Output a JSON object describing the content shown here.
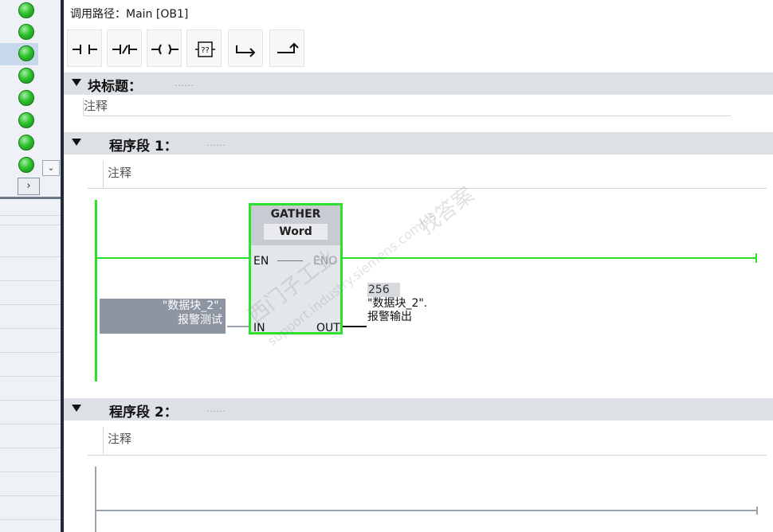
{
  "left_panel": {
    "status_icons": [
      "green-ok-icon",
      "green-ok-icon",
      "green-ok-icon",
      "green-ok-icon",
      "green-ok-icon",
      "green-ok-icon",
      "green-ok-icon",
      "green-ok-icon"
    ],
    "selected_row": 2,
    "dropdown_arrow": "⌄",
    "scroll_arrow": "›"
  },
  "editor": {
    "call_path_label": "调用路径：",
    "call_path_value": "Main [OB1]",
    "toolbar": [
      {
        "name": "normally-open-contact-button",
        "icon": "no-contact-icon"
      },
      {
        "name": "normally-closed-contact-button",
        "icon": "nc-contact-icon"
      },
      {
        "name": "coil-button",
        "icon": "coil-icon"
      },
      {
        "name": "empty-box-button",
        "icon": "empty-box-icon",
        "text": "??"
      },
      {
        "name": "open-branch-button",
        "icon": "open-branch-icon"
      },
      {
        "name": "close-branch-button",
        "icon": "close-branch-icon"
      }
    ],
    "block_title": {
      "label": "块标题：",
      "dots": "......",
      "comment": "注释"
    },
    "networks": [
      {
        "title": "程序段 1：",
        "dots": "......",
        "comment": "注释",
        "instruction": {
          "name": "GATHER",
          "type": "Word",
          "pins": {
            "en": "EN",
            "eno": "ENO",
            "in": "IN",
            "out": "OUT"
          }
        },
        "in_operand": {
          "line1": "\"数据块_2\".",
          "line2": "报警测试"
        },
        "out_operand": {
          "value": "256",
          "line1": "\"数据块_2\".",
          "line2": "报警输出"
        }
      },
      {
        "title": "程序段 2：",
        "dots": "......",
        "comment": "注释"
      }
    ],
    "watermark": {
      "line1": "西门子工业",
      "line2": "support.industry.siemens.com/cs",
      "line3": "找答案"
    }
  }
}
